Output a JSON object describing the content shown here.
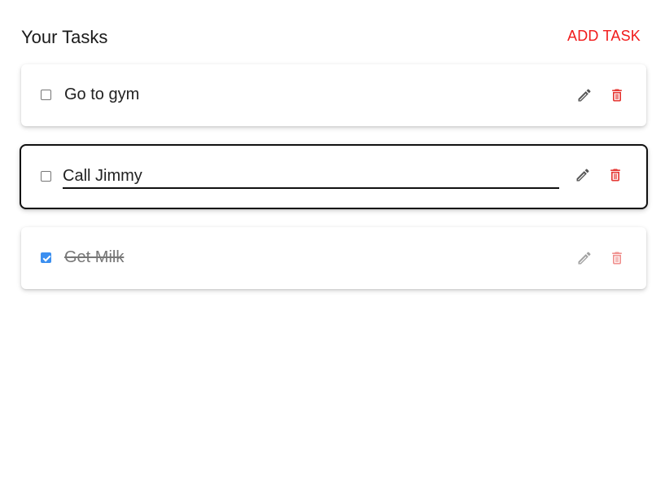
{
  "header": {
    "title": "Your Tasks",
    "add_button_label": "ADD TASK"
  },
  "colors": {
    "accent_red": "#f11b1b",
    "delete_red": "#e53935",
    "edit_gray": "#555555",
    "checkbox_blue": "#3b8ff0"
  },
  "tasks": [
    {
      "text": "Go to gym",
      "completed": false,
      "editing": false
    },
    {
      "text": "Call Jimmy",
      "completed": false,
      "editing": true
    },
    {
      "text": "Get Milk",
      "completed": true,
      "editing": false
    }
  ],
  "icons": {
    "edit": "pencil-icon",
    "delete": "trash-icon"
  }
}
